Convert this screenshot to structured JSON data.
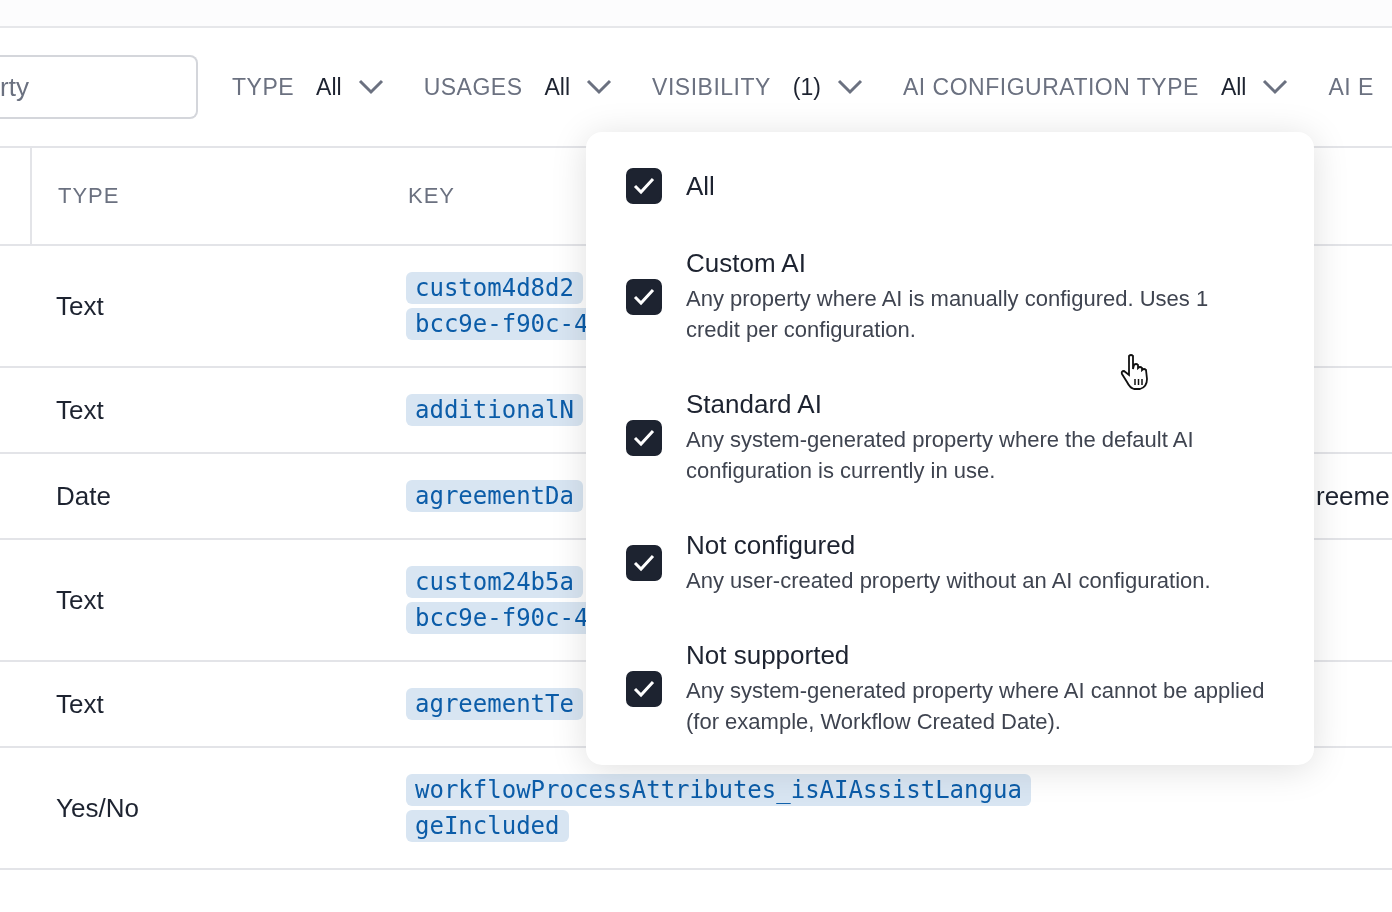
{
  "search": {
    "placeholder": "rty"
  },
  "filters": [
    {
      "label": "TYPE",
      "value": "All"
    },
    {
      "label": "USAGES",
      "value": "All"
    },
    {
      "label": "VISIBILITY",
      "value": "(1)"
    },
    {
      "label": "AI CONFIGURATION TYPE",
      "value": "All"
    },
    {
      "label": "AI E"
    }
  ],
  "table": {
    "columns": [
      "TYPE",
      "KEY"
    ],
    "rows": [
      {
        "type": "Text",
        "key": [
          "custom4d8d2",
          "bcc9e-f90c-4"
        ]
      },
      {
        "type": "Text",
        "key": [
          "additionalN"
        ]
      },
      {
        "type": "Date",
        "key": [
          "agreementDa"
        ],
        "column_3": "reeme"
      },
      {
        "type": "Text",
        "key": [
          "custom24b5a",
          "bcc9e-f90c-4"
        ]
      },
      {
        "type": "Text",
        "key": [
          "agreementTe"
        ]
      },
      {
        "type": "Yes/No",
        "key": [
          "workflowProcessAttributes_isAIAssistLangua",
          "geIncluded"
        ]
      }
    ]
  },
  "dropdown": {
    "options": [
      {
        "title": "All",
        "checked": true
      },
      {
        "title": "Custom AI",
        "description": "Any property where AI is manually configured. Uses 1 credit per configuration.",
        "checked": true
      },
      {
        "title": "Standard AI",
        "description": "Any system-generated property where the default AI configuration is currently in use.",
        "checked": true
      },
      {
        "title": "Not configured",
        "description": "Any user-created property without an AI configuration.",
        "checked": true
      },
      {
        "title": "Not supported",
        "description": "Any system-generated property where AI cannot be applied (for example, Workflow Created Date).",
        "checked": true
      }
    ]
  }
}
